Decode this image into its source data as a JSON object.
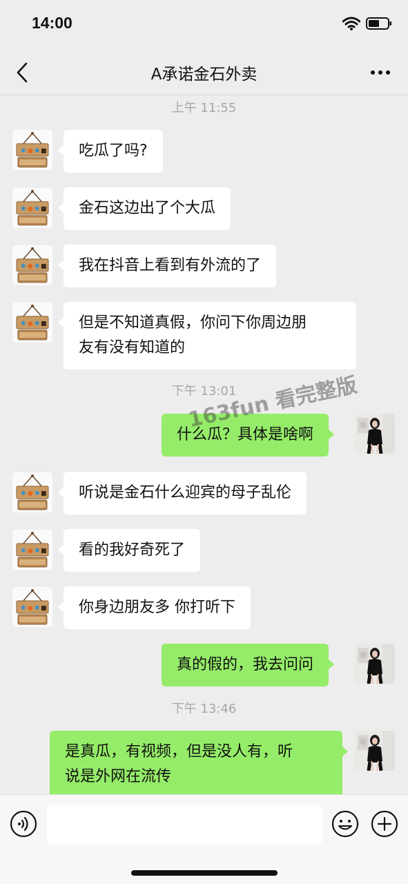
{
  "status_bar": {
    "time": "14:00"
  },
  "header": {
    "title": "A承诺金石外卖"
  },
  "messages": {
    "t1": "上午 11:55",
    "m1": "吃瓜了吗?",
    "m2": "金石这边出了个大瓜",
    "m3": "我在抖音上看到有外流的了",
    "m4_line1": "但是不知道真假，你问下你周边朋",
    "m4_line2": "友有没有知道的",
    "t2": "下午 13:01",
    "m5": "什么瓜？具体是啥啊",
    "m6": "听说是金石什么迎宾的母子乱伦",
    "m7": "看的我好奇死了",
    "m8": "你身边朋友多 你打听下",
    "m9": "真的假的，我去问问",
    "t3": "下午 13:46",
    "m10_line1": "是真瓜，有视频，但是没人有，听",
    "m10_line2": "说是外网在流传"
  },
  "contact_avatar": {
    "sign_text": "正在营业"
  },
  "watermark": "163fun 看完整版",
  "input": {
    "value": ""
  },
  "colors": {
    "background": "#ededed",
    "self_bubble": "#95ec69",
    "other_bubble": "#ffffff",
    "timestamp": "#a6a6a6"
  }
}
